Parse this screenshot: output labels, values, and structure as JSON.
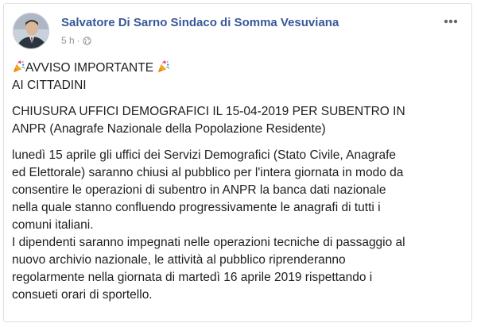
{
  "post": {
    "author": "Salvatore Di Sarno Sindaco di Somma Vesuviana",
    "time": "5 h",
    "separator": "·",
    "privacy_icon": "globe-icon",
    "more_icon": "more-options-icon",
    "headline_emoji": "party-popper-icon",
    "headline": "AVVISO IMPORTANTE",
    "audience": "AI CITTADINI",
    "subject_lines": [
      "CHIUSURA UFFICI DEMOGRAFICI IL 15-04-2019 PER SUBENTRO IN",
      "ANPR (Anagrafe Nazionale della Popolazione Residente)"
    ],
    "body_lines": [
      "lunedì 15 aprile gli uffici dei Servizi Demografici (Stato Civile, Anagrafe",
      "ed Elettorale) saranno chiusi al pubblico per l'intera giornata in modo da",
      "consentire le operazioni di subentro in ANPR la banca dati nazionale",
      "nella quale stanno confluendo progressivamente le anagrafi di tutti i",
      "comuni italiani.",
      "I dipendenti saranno impegnati nelle operazioni tecniche di passaggio al",
      "nuovo archivio nazionale, le attività al pubblico riprenderanno",
      "regolarmente nella giornata di martedì 16 aprile 2019 rispettando i",
      "consueti orari di sportello."
    ]
  }
}
